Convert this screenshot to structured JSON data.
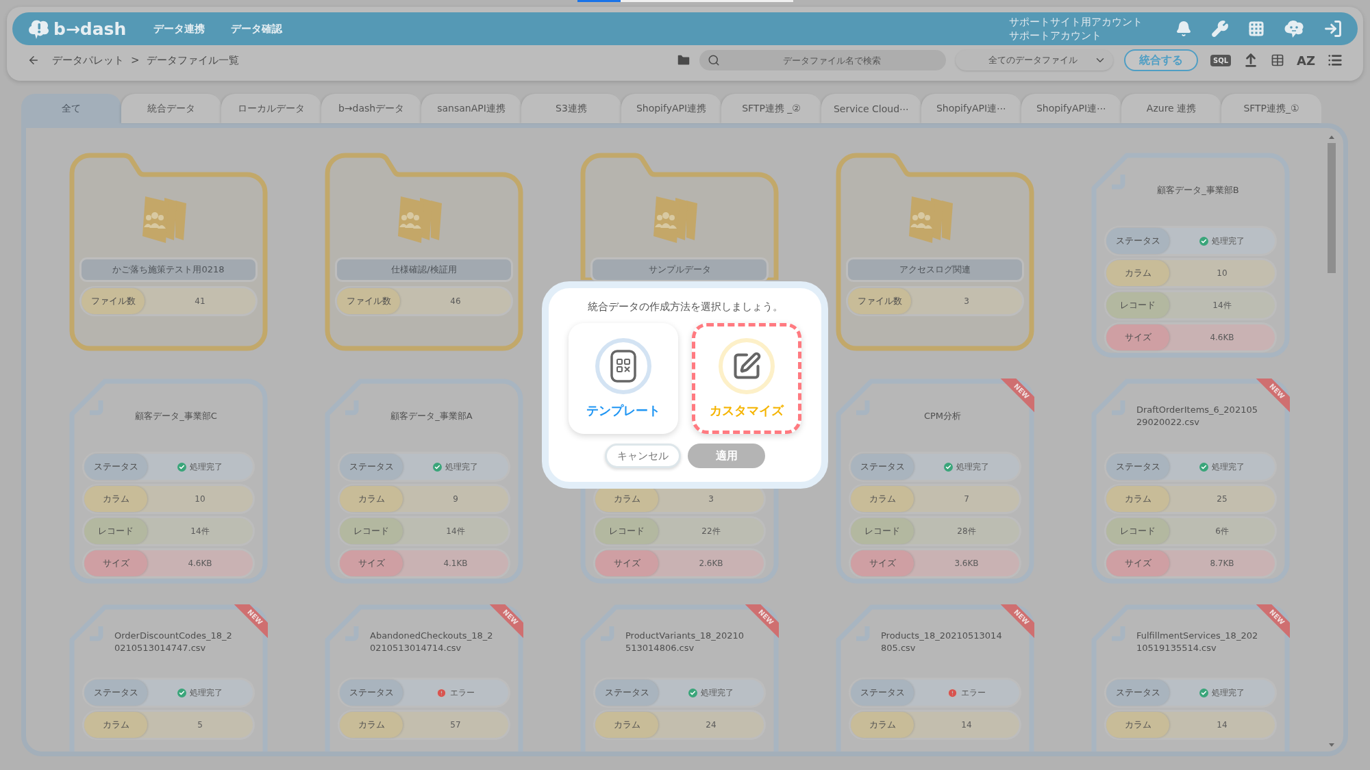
{
  "loading_bar": {
    "level": 0.2
  },
  "header": {
    "logo": "b→dash",
    "nav": [
      "データ連携",
      "データ確認"
    ],
    "account": [
      "サポートサイト用アカウント",
      "サポートアカウント"
    ]
  },
  "toolbar": {
    "breadcrumb": [
      "データパレット",
      "データファイル一覧"
    ],
    "separator": ">",
    "search": {
      "placeholder": "データファイル名で検索"
    },
    "filter": "全てのデータファイル",
    "merge_button": "統合する",
    "sql_label": "SQL",
    "sort_label": "AZ"
  },
  "tabs": [
    {
      "label": "全て",
      "selected": true
    },
    {
      "label": "統合データ",
      "selected": false
    },
    {
      "label": "ローカルデータ",
      "selected": false
    },
    {
      "label": "b→dashデータ",
      "selected": false
    },
    {
      "label": "sansanAPI連携",
      "selected": false
    },
    {
      "label": "S3連携",
      "selected": false
    },
    {
      "label": "ShopifyAPI連携",
      "selected": false
    },
    {
      "label": "SFTP連携 _②",
      "selected": false
    },
    {
      "label": "Service Cloud⋯",
      "selected": false
    },
    {
      "label": "ShopifyAPI連⋯",
      "selected": false
    },
    {
      "label": "ShopifyAPI連⋯",
      "selected": false
    },
    {
      "label": "Azure 連携",
      "selected": false
    },
    {
      "label": "SFTP連携_①",
      "selected": false
    }
  ],
  "cards": [
    {
      "kind": "folder",
      "name": "かご落ち施策テスト用0218",
      "fields": [
        {
          "kind": "count",
          "label": "ファイル数",
          "value": "41"
        }
      ]
    },
    {
      "kind": "folder",
      "name": "仕様確認/検証用",
      "fields": [
        {
          "kind": "count",
          "label": "ファイル数",
          "value": "46"
        }
      ]
    },
    {
      "kind": "folder",
      "name": "サンプルデータ"
    },
    {
      "kind": "folder",
      "name": "アクセスログ関連",
      "fields": [
        {
          "kind": "count",
          "label": "ファイル数",
          "value": "3"
        }
      ]
    },
    {
      "kind": "file",
      "name": "顧客データ_事業部B",
      "fields": [
        {
          "kind": "status",
          "label": "ステータス",
          "value": "処理完了",
          "done": true
        },
        {
          "kind": "columns",
          "label": "カラム",
          "value": "10"
        },
        {
          "kind": "records",
          "label": "レコード",
          "value": "14件"
        },
        {
          "kind": "size",
          "label": "サイズ",
          "value": "4.6KB"
        }
      ]
    },
    {
      "kind": "file",
      "name": "顧客データ_事業部C",
      "fields": [
        {
          "kind": "status",
          "label": "ステータス",
          "value": "処理完了",
          "done": true
        },
        {
          "kind": "columns",
          "label": "カラム",
          "value": "10"
        },
        {
          "kind": "records",
          "label": "レコード",
          "value": "14件"
        },
        {
          "kind": "size",
          "label": "サイズ",
          "value": "4.6KB"
        }
      ]
    },
    {
      "kind": "file",
      "name": "顧客データ_事業部A",
      "fields": [
        {
          "kind": "status",
          "label": "ステータス",
          "value": "処理完了",
          "done": true
        },
        {
          "kind": "columns",
          "label": "カラム",
          "value": "9"
        },
        {
          "kind": "records",
          "label": "レコード",
          "value": "14件"
        },
        {
          "kind": "size",
          "label": "サイズ",
          "value": "4.1KB"
        }
      ]
    },
    {
      "kind": "file",
      "fields": [
        {
          "kind": "columns",
          "label": "カラム",
          "value": "3"
        },
        {
          "kind": "records",
          "label": "レコード",
          "value": "22件"
        },
        {
          "kind": "size",
          "label": "サイズ",
          "value": "2.6KB"
        }
      ]
    },
    {
      "kind": "file",
      "name": "CPM分析",
      "badge": "NEW",
      "fields": [
        {
          "kind": "status",
          "label": "ステータス",
          "value": "処理完了",
          "done": true
        },
        {
          "kind": "columns",
          "label": "カラム",
          "value": "7"
        },
        {
          "kind": "records",
          "label": "レコード",
          "value": "28件"
        },
        {
          "kind": "size",
          "label": "サイズ",
          "value": "3.6KB"
        }
      ]
    },
    {
      "kind": "file",
      "name": "DraftOrderItems_6_20210529020022.csv",
      "badge": "NEW",
      "fields": [
        {
          "kind": "status",
          "label": "ステータス",
          "value": "処理完了",
          "done": true
        },
        {
          "kind": "columns",
          "label": "カラム",
          "value": "25"
        },
        {
          "kind": "records",
          "label": "レコード",
          "value": "6件"
        },
        {
          "kind": "size",
          "label": "サイズ",
          "value": "8.7KB"
        }
      ]
    },
    {
      "kind": "file",
      "name": "OrderDiscountCodes_18_20210513014747.csv",
      "badge": "NEW",
      "fields": [
        {
          "kind": "status",
          "label": "ステータス",
          "value": "処理完了",
          "done": true
        },
        {
          "kind": "columns",
          "label": "カラム",
          "value": "5"
        }
      ]
    },
    {
      "kind": "file",
      "name": "AbandonedCheckouts_18_20210513014714.csv",
      "badge": "NEW",
      "fields": [
        {
          "kind": "status",
          "label": "ステータス",
          "value": "エラー",
          "done": false
        },
        {
          "kind": "columns",
          "label": "カラム",
          "value": "57"
        }
      ]
    },
    {
      "kind": "file",
      "name": "ProductVariants_18_20210513014806.csv",
      "badge": "NEW",
      "fields": [
        {
          "kind": "status",
          "label": "ステータス",
          "value": "処理完了",
          "done": true
        },
        {
          "kind": "columns",
          "label": "カラム",
          "value": "24"
        }
      ]
    },
    {
      "kind": "file",
      "name": "Products_18_20210513014805.csv",
      "badge": "NEW",
      "fields": [
        {
          "kind": "status",
          "label": "ステータス",
          "value": "エラー",
          "done": false
        },
        {
          "kind": "columns",
          "label": "カラム",
          "value": "14"
        }
      ]
    },
    {
      "kind": "file",
      "name": "FulfillmentServices_18_20210519135514.csv",
      "badge": "NEW",
      "fields": [
        {
          "kind": "status",
          "label": "ステータス",
          "value": "処理完了",
          "done": true
        },
        {
          "kind": "columns",
          "label": "カラム",
          "value": "14"
        }
      ]
    }
  ],
  "dialog": {
    "title": "統合データの作成方法を選択しましょう。",
    "options": [
      {
        "kind": "template",
        "label": "テンプレート",
        "selected": false
      },
      {
        "kind": "custom",
        "label": "カスタマイズ",
        "selected": true
      }
    ],
    "cancel_button": "キャンセル",
    "apply_button": {
      "label": "適用",
      "disabled": true
    }
  }
}
